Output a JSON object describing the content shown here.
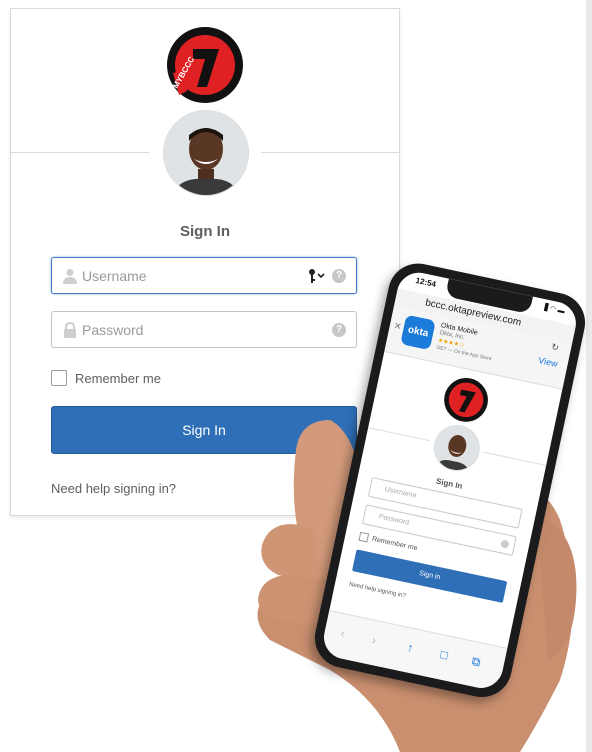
{
  "card": {
    "logo_text": "MYBCCC",
    "title": "Sign In",
    "username_placeholder": "Username",
    "password_placeholder": "Password",
    "remember_label": "Remember me",
    "signin_button": "Sign In",
    "help_link": "Need help signing in?",
    "help_glyph": "?"
  },
  "phone": {
    "status_time": "12:54",
    "status_icons": "▋◠ ▬",
    "url": "bccc.oktapreview.com",
    "banner": {
      "close": "✕",
      "app_icon_text": "okta",
      "app_name": "Okta Mobile",
      "publisher": "Okta, Inc.",
      "stars": "★★★★☆",
      "store_text": "GET — On the App Store",
      "view_label": "View",
      "reload": "↻"
    },
    "title": "Sign In",
    "username_placeholder": "Username",
    "password_placeholder": "Password",
    "remember_label": "Remember me",
    "signin_button": "Sign in",
    "help_link": "Need help signing in?",
    "toolbar": {
      "back": "‹",
      "forward": "›",
      "share": "↑",
      "bookmarks": "□",
      "tabs": "⧉"
    }
  },
  "colors": {
    "primary": "#2f6fb7",
    "focus_border": "#4a7ec6",
    "logo_red": "#e02124",
    "okta_blue": "#1a7bd8"
  }
}
